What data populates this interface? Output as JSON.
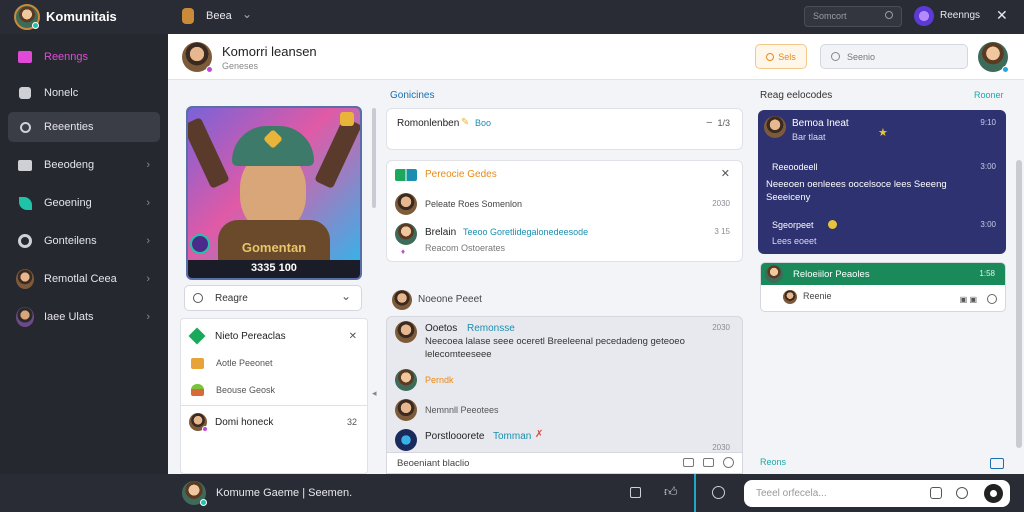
{
  "topbar": {
    "app_title": "Komunitais",
    "channel": "Beea",
    "search_placeholder": "Somcort",
    "user_label": "Reenngs"
  },
  "sidebar": {
    "items": [
      {
        "label": "Reenngs",
        "icon": "gift-icon",
        "color": "#e04ad6"
      },
      {
        "label": "Nonelc",
        "icon": "bag-icon",
        "color": "#cfd0d6"
      },
      {
        "label": "Reeenties",
        "icon": "search-icon",
        "color": "#cfd0d6"
      },
      {
        "label": "Beeodeng",
        "icon": "folder-icon",
        "color": "#cfd0d6"
      },
      {
        "label": "Geoening",
        "icon": "leaf-icon",
        "color": "#1fc4a8"
      },
      {
        "label": "Gonteilens",
        "icon": "record-icon",
        "color": "#cfd0d6"
      },
      {
        "label": "Remotlal Ceea",
        "icon": "avatar-icon",
        "color": "#cfd0d6"
      },
      {
        "label": "Iaee Ulats",
        "icon": "avatar-icon",
        "color": "#cfd0d6"
      }
    ]
  },
  "header": {
    "name": "Komorri leansen",
    "subtitle": "Geneses",
    "action_label": "Sels",
    "search_placeholder": "Seenio"
  },
  "profile_card": {
    "caption": "Gomentan",
    "stats": "3335  100",
    "dropdown": "Reagre",
    "accent": "#1fc4a8"
  },
  "left_list": {
    "items": [
      {
        "label": "Nieto Pereaclas",
        "icon": "diamond-icon",
        "color": "#1aa85a"
      },
      {
        "label": "Aotle Peeonet",
        "icon": "chest-icon",
        "color": "#e8a23a"
      },
      {
        "label": "Beouse Geosk",
        "icon": "cake-icon",
        "color": "#d86a3a"
      }
    ],
    "footer_label": "Domi honeck",
    "footer_count": "32"
  },
  "center": {
    "section_title": "Gonicines",
    "top_card": {
      "name": "Romonlenben",
      "tag": "Boo",
      "time": "1/3"
    },
    "notif_card": {
      "title": "Pereocie Gedes",
      "rows": [
        {
          "text": "Peleate Roes Somenlon",
          "time": "2030"
        },
        {
          "name": "Brelain",
          "text": "Teeoo Goretlidegalonedeesode",
          "sub": "Reacom Ostoerates",
          "time": "3 15"
        }
      ]
    },
    "chat_header": "Noeone Peeet",
    "messages": [
      {
        "name": "Ooetos",
        "name2": "Remonsse",
        "text": "Neecoea lalase seee oceretl Breeleenal pecedadeng geteoeo lelecomteeseee",
        "time": "2030"
      },
      {
        "name": "Perndk",
        "text": "",
        "time": ""
      },
      {
        "name": "Nemnnll Peeotees",
        "text": "",
        "time": ""
      },
      {
        "name": "Porstlooorete",
        "name2": "Tomman",
        "text": "",
        "time": "2030"
      }
    ],
    "composer": "Beoeniant blaclio"
  },
  "right": {
    "title": "Reag eelocodes",
    "link": "Rooner",
    "purple_card": {
      "name": "Bemoa Ineat",
      "sub": "Bar tlaat",
      "time1": "9:10",
      "label": "Reeoodeell",
      "time2": "3:00",
      "text": "Neeeoen oenleees oocelsoce lees Seeeng Seeeiceny",
      "price": "Sgeorpeet",
      "time3": "3:00",
      "footer": "Lees eoeet"
    },
    "green_card": {
      "title": "Reloeiilor Peaoles",
      "time": "1:58",
      "row": "Reenie"
    },
    "bottom_link": "Reons"
  },
  "bottombar": {
    "game_label": "Komume Gaeme | Seemen.",
    "input_placeholder": "Teeel orfecela..."
  }
}
